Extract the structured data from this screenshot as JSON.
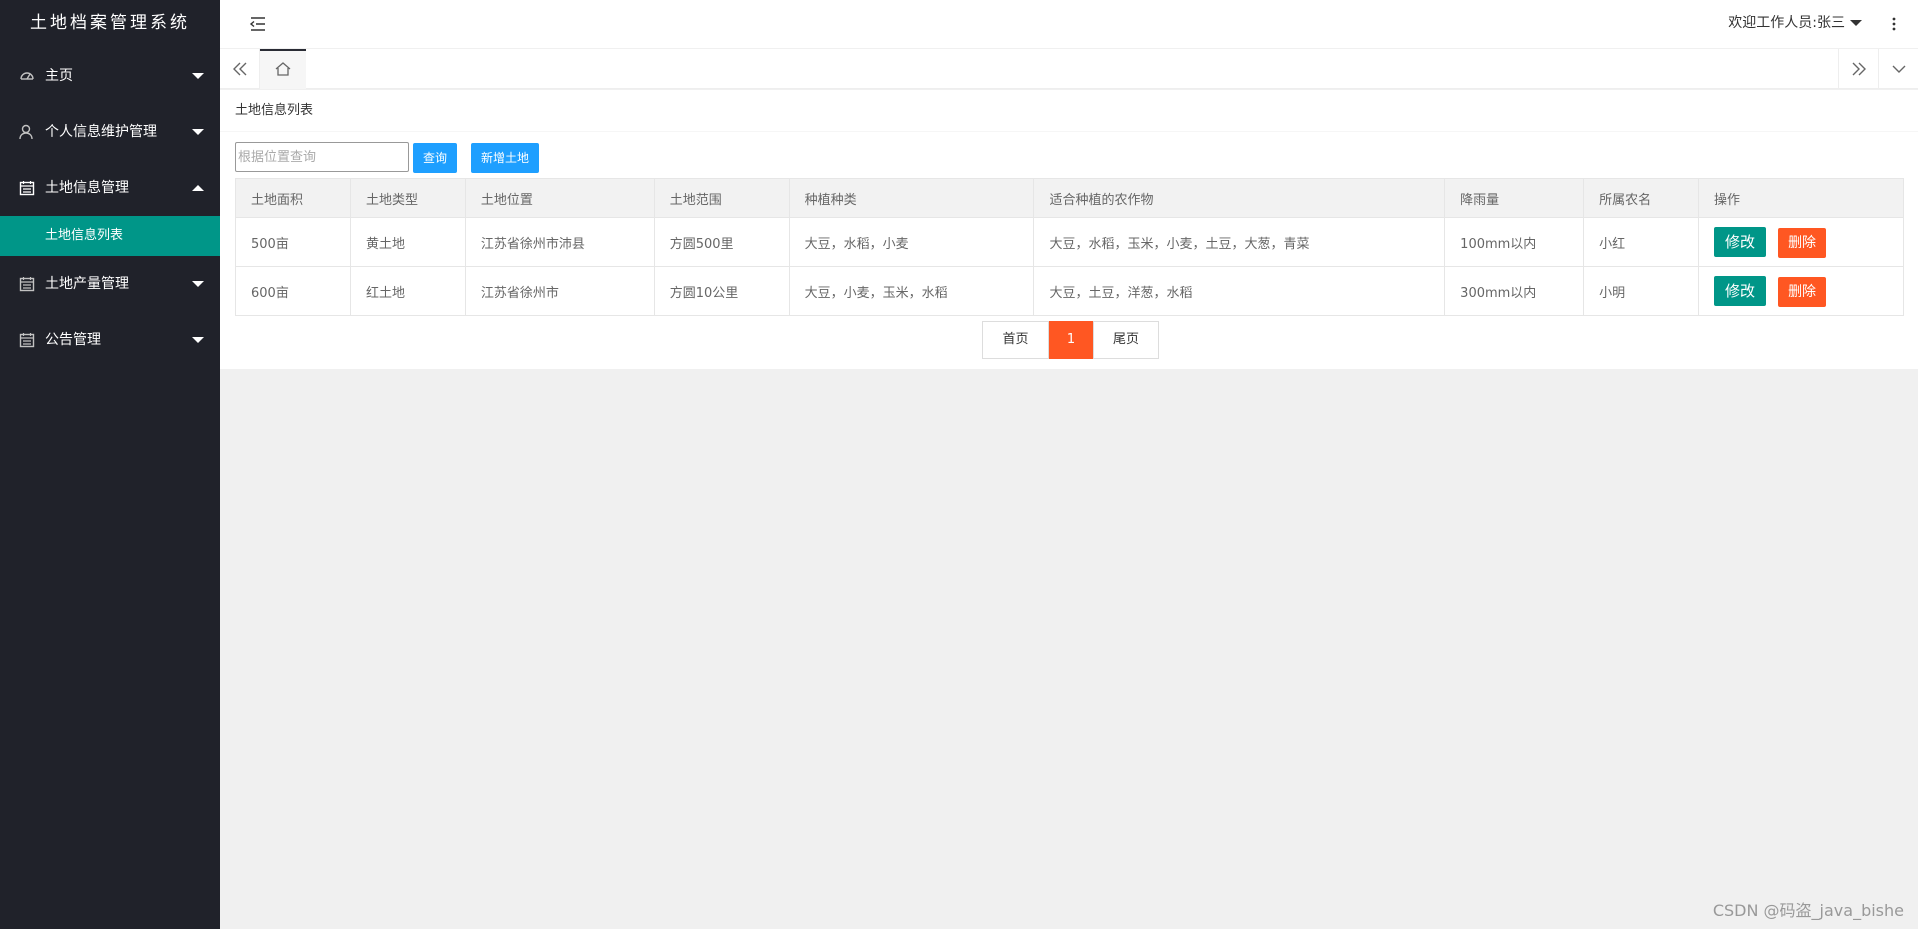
{
  "app": {
    "title": "土地档案管理系统"
  },
  "sidebar": {
    "items": [
      {
        "label": "主页",
        "icon": "gauge-icon",
        "expanded": false
      },
      {
        "label": "个人信息维护管理",
        "icon": "user-icon",
        "expanded": false
      },
      {
        "label": "土地信息管理",
        "icon": "calendar-icon",
        "expanded": true,
        "children": [
          {
            "label": "土地信息列表",
            "active": true
          }
        ]
      },
      {
        "label": "土地产量管理",
        "icon": "calendar-icon",
        "expanded": false
      },
      {
        "label": "公告管理",
        "icon": "calendar-icon",
        "expanded": false
      }
    ]
  },
  "header": {
    "welcome": "欢迎工作人员:张三"
  },
  "page": {
    "title": "土地信息列表"
  },
  "search": {
    "placeholder": "根据位置查询",
    "value": ""
  },
  "toolbar": {
    "query_label": "查询",
    "add_label": "新增土地"
  },
  "table": {
    "columns": [
      "土地面积",
      "土地类型",
      "土地位置",
      "土地范围",
      "种植种类",
      "适合种植的农作物",
      "降雨量",
      "所属农名",
      "操作"
    ],
    "rows": [
      {
        "area": "500亩",
        "type": "黄土地",
        "location": "江苏省徐州市沛县",
        "range": "方圆500里",
        "crops": "大豆，水稻，小麦",
        "suitable": "大豆，水稻，玉米，小麦，土豆，大葱，青菜",
        "rainfall": "100mm以内",
        "farmer": "小红"
      },
      {
        "area": "600亩",
        "type": "红土地",
        "location": "江苏省徐州市",
        "range": "方圆10公里",
        "crops": "大豆，小麦，玉米，水稻",
        "suitable": "大豆，土豆，洋葱，水稻",
        "rainfall": "300mm以内",
        "farmer": "小明"
      }
    ],
    "edit_label": "修改",
    "delete_label": "删除"
  },
  "pagination": {
    "first": "首页",
    "current": "1",
    "last": "尾页"
  },
  "watermark": "CSDN @码盗_java_bishe",
  "colors": {
    "sidebar_bg": "#20222a",
    "active": "#009688",
    "primary": "#1e9fff",
    "danger": "#ff5722"
  }
}
